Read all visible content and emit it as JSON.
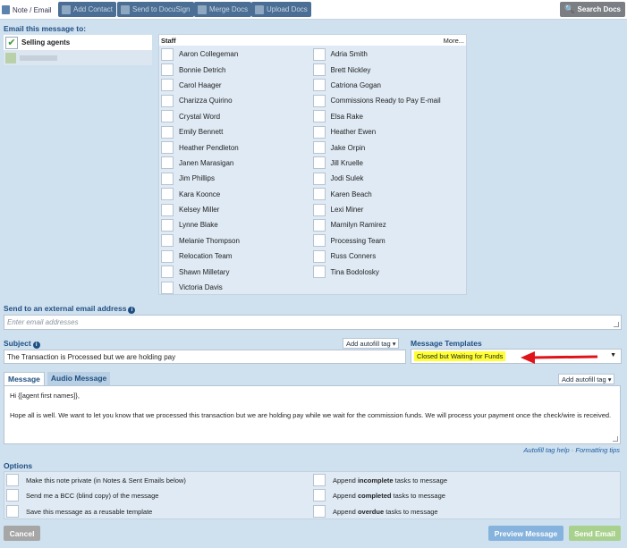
{
  "toolbar": {
    "note_email": "Note / Email",
    "add_contact": "Add Contact",
    "send_docusign": "Send to DocuSign",
    "merge_docs": "Merge Docs",
    "upload_docs": "Upload Docs",
    "search_docs": "Search Docs"
  },
  "recipients": {
    "label": "Email this message to:",
    "items": [
      {
        "label": "Selling agents"
      }
    ]
  },
  "staff": {
    "header": "Staff",
    "more": "More...",
    "left": [
      "Aaron Collegeman",
      "Bonnie Detrich",
      "Carol Haager",
      "Charizza Quirino",
      "Crystal Word",
      "Emily Bennett",
      "Heather Pendleton",
      "Janen Marasigan",
      "Jim Phillips",
      "Kara Koonce",
      "Kelsey Miller",
      "Lynne Blake",
      "Melanie Thompson",
      "Relocation Team",
      "Shawn Milletary",
      "Victoria Davis"
    ],
    "right": [
      "Adria Smith",
      "Brett Nickley",
      "Catriona Gogan",
      "Commissions Ready to Pay E-mail",
      "Elsa Rake",
      "Heather Ewen",
      "Jake Orpin",
      "Jill Kruelle",
      "Jodi Sulek",
      "Karen Beach",
      "Lexi Miner",
      "Marnilyn Ramirez",
      "Processing Team",
      "Russ Conners",
      "Tina Bodolosky"
    ]
  },
  "external": {
    "label": "Send to an external email address",
    "placeholder": "Enter email addresses"
  },
  "subject": {
    "label": "Subject",
    "value": "The Transaction is Processed but we are holding pay",
    "autofill": "Add autofill tag"
  },
  "templates": {
    "label": "Message Templates",
    "selected": "Closed but Waiting for Funds"
  },
  "message": {
    "tab_message": "Message",
    "tab_audio": "Audio Message",
    "autofill": "Add autofill tag",
    "line1": "Hi {[agent first names]},",
    "line2": "Hope all is well. We want to let you know that we processed this transaction but we are holding pay while we wait for the commission funds. We will process your payment once the check/wire is received.",
    "help_link": "Autofill tag help",
    "sep": "·",
    "tips_link": "Formatting tips"
  },
  "options": {
    "label": "Options",
    "left": [
      "Make this note private (in Notes & Sent Emails below)",
      "Send me a BCC (blind copy) of the message",
      "Save this message as a reusable template"
    ],
    "right": [
      {
        "pre": "Append ",
        "bold": "incomplete",
        "post": " tasks to message"
      },
      {
        "pre": "Append ",
        "bold": "completed",
        "post": " tasks to message"
      },
      {
        "pre": "Append ",
        "bold": "overdue",
        "post": " tasks to message"
      }
    ]
  },
  "buttons": {
    "cancel": "Cancel",
    "preview": "Preview Message",
    "send": "Send Email"
  }
}
